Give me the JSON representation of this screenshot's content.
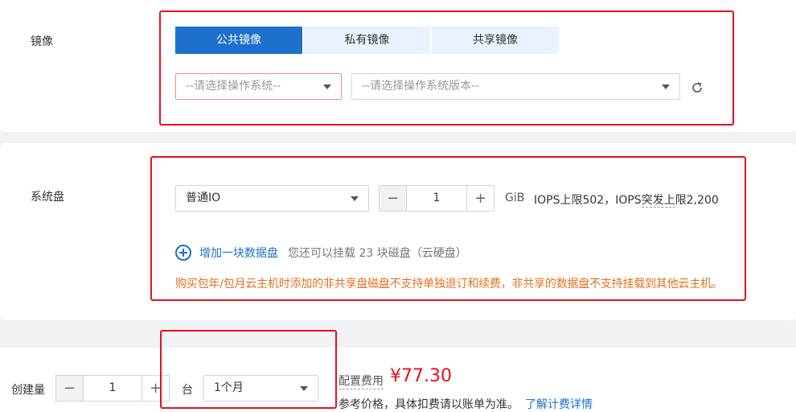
{
  "image_section": {
    "label": "镜像",
    "tabs": [
      "公共镜像",
      "私有镜像",
      "共享镜像"
    ],
    "os_select_placeholder": "--请选择操作系统--",
    "os_version_select_placeholder": "--请选择操作系统版本--"
  },
  "disk_section": {
    "label": "系统盘",
    "disk_type": "普通IO",
    "size_value": "1",
    "unit": "GiB",
    "iops": "IOPS上限502，IOPS突发上限2,200",
    "iops_prefix": "IOPS上限502，IOPS",
    "iops_dotted": "突发上",
    "iops_suffix": "限2,200",
    "add_disk_label": "增加一块数据盘",
    "add_disk_hint": "您还可以挂载 23 块磁盘（云硬盘）",
    "warning": "购买包年/包月云主机时添加的非共享盘磁盘不支持单独退订和续费，非共享的数据盘不支持挂载到其他云主机。"
  },
  "bottom": {
    "quantity_label": "创建量",
    "quantity_value": "1",
    "quantity_unit": "台",
    "duration": "1个月",
    "fee_label": "配置费用",
    "price": "¥77.30",
    "reference_text": "参考价格，具体扣费请以账单为准。",
    "pricing_link": "了解计费详情"
  },
  "colors": {
    "accent": "#1d70cc",
    "highlight_box": "#e8101a",
    "warning": "#e27121",
    "price": "#e8101a"
  }
}
